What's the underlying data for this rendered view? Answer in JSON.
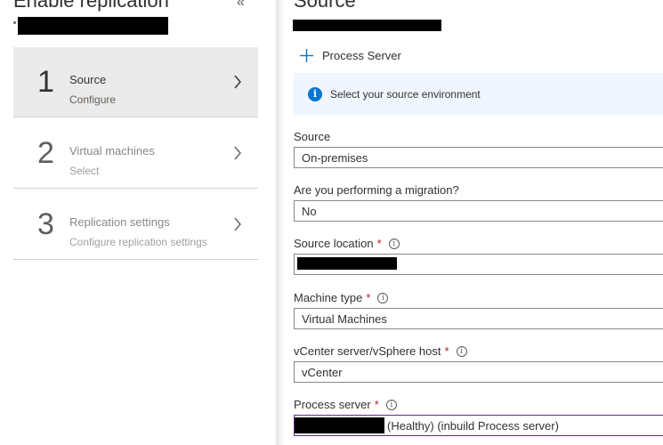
{
  "left_blade": {
    "title": "Enable replication",
    "collapse_icon": "double-chevron-left-icon",
    "steps": [
      {
        "number": "1",
        "title": "Source",
        "subtitle": "Configure",
        "state": "active"
      },
      {
        "number": "2",
        "title": "Virtual machines",
        "subtitle": "Select",
        "state": "inactive"
      },
      {
        "number": "3",
        "title": "Replication settings",
        "subtitle": "Configure replication settings",
        "state": "inactive"
      }
    ]
  },
  "right_blade": {
    "title": "Source",
    "toolbar": {
      "process_server_label": "Process Server",
      "icon": "plus-icon"
    },
    "info": {
      "text": "Select your source environment",
      "icon": "info-icon"
    },
    "fields": {
      "source": {
        "label": "Source",
        "value": "On-premises"
      },
      "migration": {
        "label": "Are you performing a migration?",
        "value": "No"
      },
      "source_location": {
        "label": "Source location",
        "required": true
      },
      "machine_type": {
        "label": "Machine type",
        "value": "Virtual Machines",
        "required": true
      },
      "vcenter": {
        "label": "vCenter server/vSphere host",
        "value": "vCenter",
        "required": true
      },
      "process_server": {
        "label": "Process server",
        "value_suffix": "(Healthy) (inbuild Process server)",
        "required": true
      }
    },
    "required_marker": "*",
    "tooltip_glyph": "i"
  },
  "colors": {
    "accent": "#0078d4",
    "required": "#a4262c",
    "active_step_bg": "#edebe9",
    "info_bg": "#f0f6ff",
    "focus_border": "#5c2d91"
  }
}
